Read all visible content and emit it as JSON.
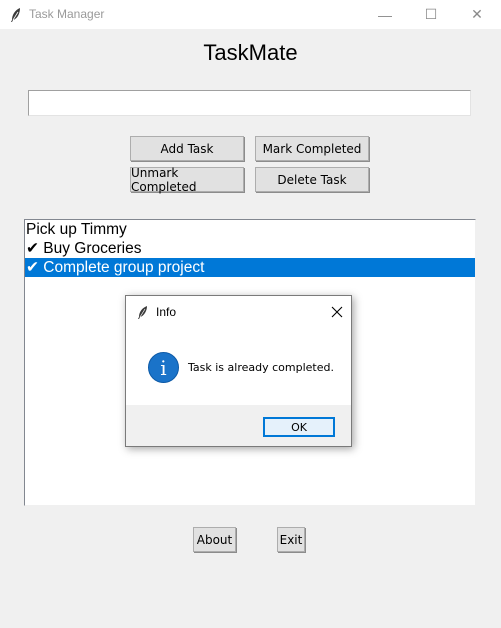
{
  "window": {
    "title": "Task Manager",
    "minimize": "—",
    "maximize": "☐",
    "close": "✕"
  },
  "app": {
    "heading": "TaskMate",
    "input": {
      "value": "",
      "placeholder": ""
    }
  },
  "buttons": {
    "add": "Add Task",
    "mark": "Mark Completed",
    "unmark": "Unmark Completed",
    "delete": "Delete Task",
    "about": "About",
    "exit": "Exit"
  },
  "tasks": {
    "items": [
      {
        "label": "Pick up Timmy",
        "completed": false,
        "selected": false
      },
      {
        "label": "✔ Buy Groceries",
        "completed": true,
        "selected": false
      },
      {
        "label": "✔ Complete group project",
        "completed": true,
        "selected": true
      }
    ]
  },
  "dialog": {
    "title": "Info",
    "message": "Task is already completed.",
    "ok": "OK",
    "info_glyph": "i",
    "icon": "info-icon"
  },
  "colors": {
    "selection": "#0078d7",
    "info_icon": "#1a73c9",
    "window_bg": "#f0f0f0"
  }
}
